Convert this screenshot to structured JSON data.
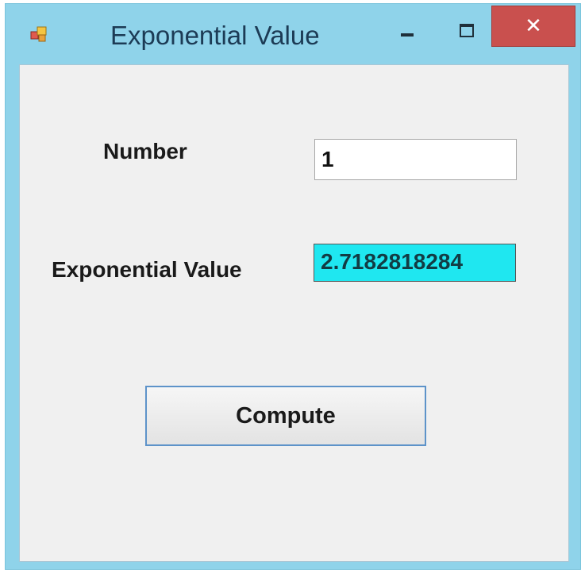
{
  "window": {
    "title": "Exponential Value",
    "icon": "windows-form-icon",
    "controls": {
      "minimize_icon": "minimize-icon",
      "maximize_icon": "maximize-icon",
      "close_symbol": "✕"
    }
  },
  "form": {
    "number_label": "Number",
    "number_value": "1",
    "exp_label": "Exponential Value",
    "exp_value": "2.7182818284",
    "compute_label": "Compute"
  },
  "colors": {
    "frame": "#8fd3ea",
    "close_button": "#c9504e",
    "client": "#f0f0f0",
    "result_background": "#1fe7f0",
    "button_border": "#5d93c9"
  }
}
